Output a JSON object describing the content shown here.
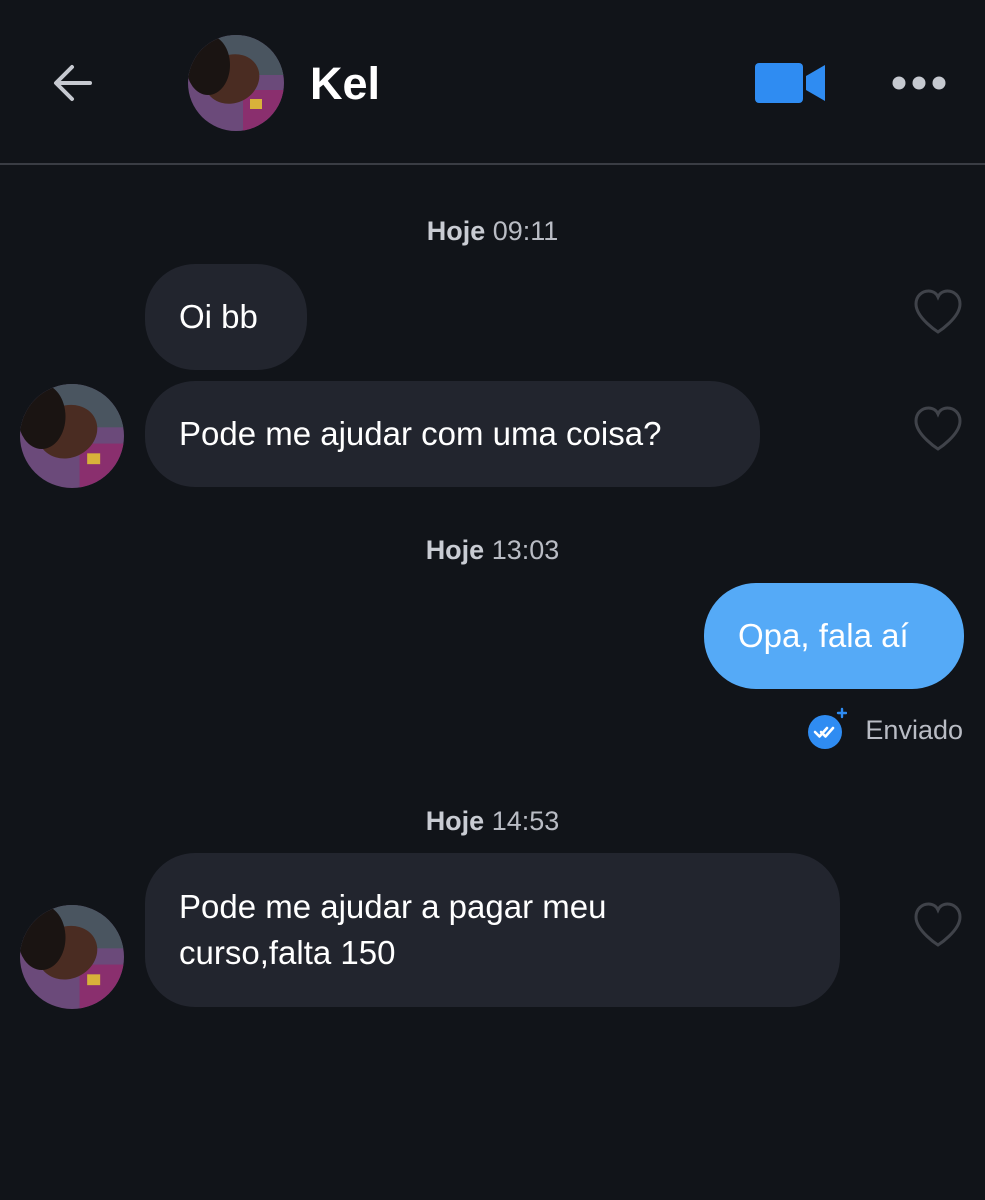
{
  "header": {
    "contact_name": "Kel",
    "back_icon": "back-arrow-icon",
    "video_icon": "video-camera-icon",
    "more_icon": "more-dots-icon"
  },
  "colors": {
    "background": "#111419",
    "incoming_bubble": "#22252e",
    "outgoing_bubble": "#55aaf7",
    "accent": "#2f8cf2"
  },
  "conversation": {
    "groups": [
      {
        "day": "Hoje",
        "time": "09:11"
      },
      {
        "day": "Hoje",
        "time": "13:03"
      },
      {
        "day": "Hoje",
        "time": "14:53"
      }
    ],
    "messages": [
      {
        "direction": "incoming",
        "text": "Oi bb"
      },
      {
        "direction": "incoming",
        "text": "Pode me ajudar com uma coisa?"
      },
      {
        "direction": "outgoing",
        "text": "Opa, fala aí",
        "status": "Enviado"
      },
      {
        "direction": "incoming",
        "text": "Pode me ajudar a pagar meu curso,falta 150"
      }
    ]
  }
}
